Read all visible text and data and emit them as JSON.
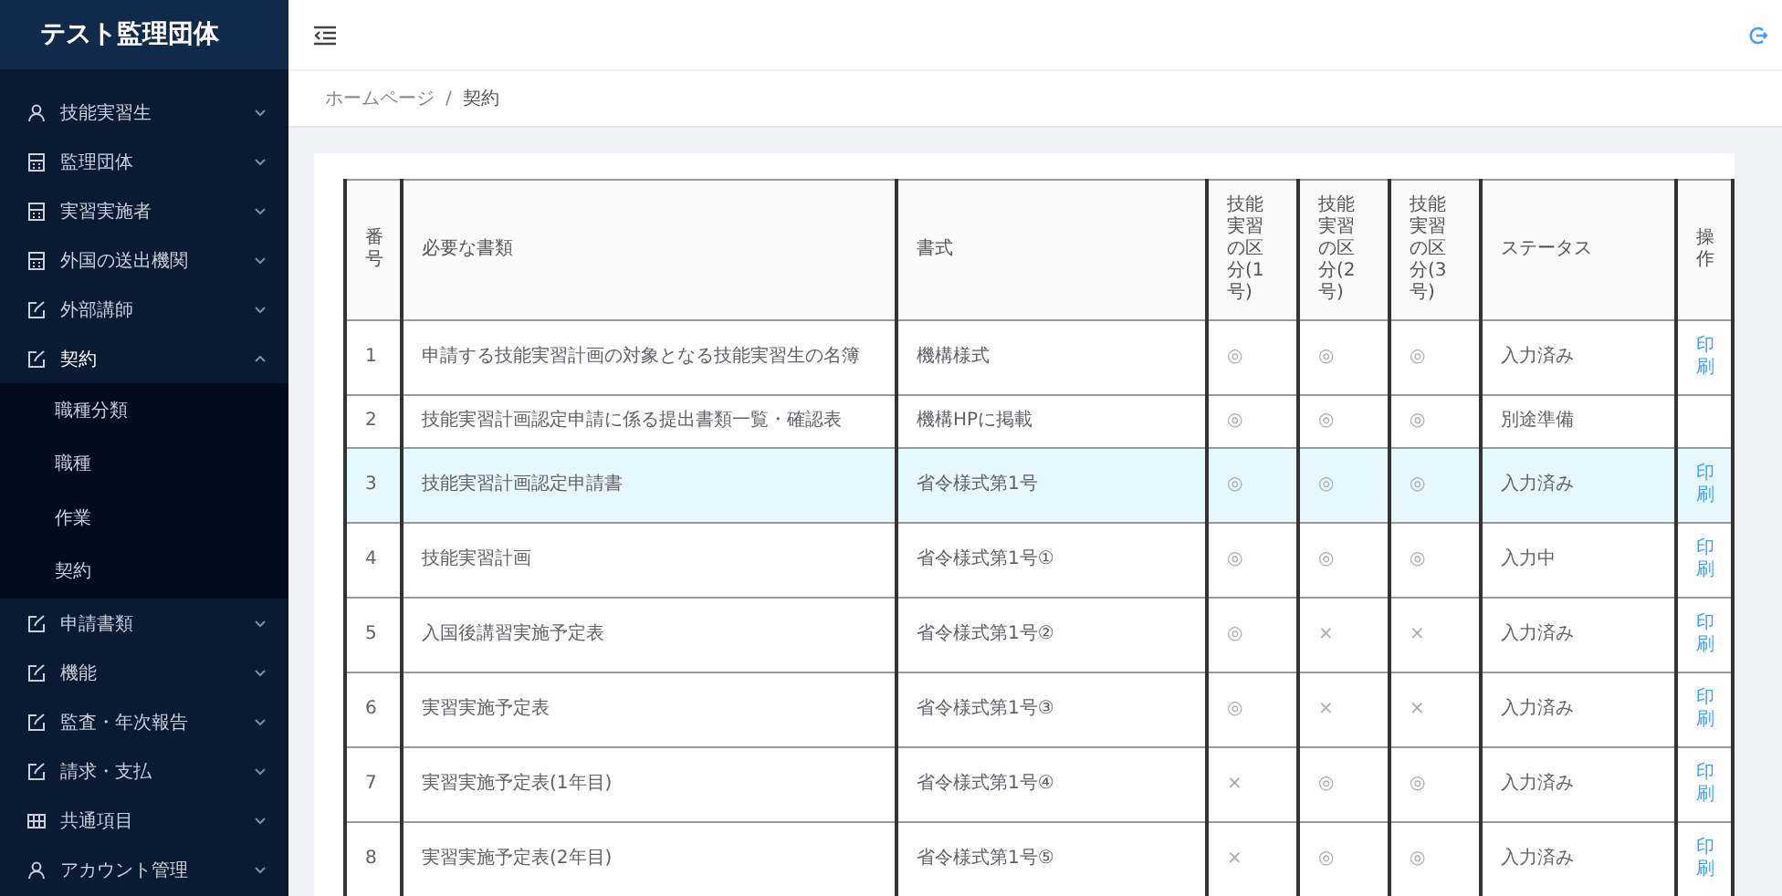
{
  "sidebar": {
    "title": "テスト監理団体",
    "items": [
      {
        "label": "技能実習生",
        "kind": "person",
        "expanded": false
      },
      {
        "label": "監理団体",
        "kind": "building",
        "expanded": false
      },
      {
        "label": "実習実施者",
        "kind": "building",
        "expanded": false
      },
      {
        "label": "外国の送出機関",
        "kind": "building",
        "expanded": false
      },
      {
        "label": "外部講師",
        "kind": "edit",
        "expanded": false
      },
      {
        "label": "契約",
        "kind": "edit",
        "expanded": true,
        "children": [
          {
            "label": "職種分類"
          },
          {
            "label": "職種"
          },
          {
            "label": "作業"
          },
          {
            "label": "契約"
          }
        ]
      },
      {
        "label": "申請書類",
        "kind": "edit",
        "expanded": false
      },
      {
        "label": "機能",
        "kind": "edit",
        "expanded": false
      },
      {
        "label": "監査・年次報告",
        "kind": "edit",
        "expanded": false
      },
      {
        "label": "請求・支払",
        "kind": "edit",
        "expanded": false
      },
      {
        "label": "共通項目",
        "kind": "grid",
        "expanded": false
      },
      {
        "label": "アカウント管理",
        "kind": "person",
        "expanded": false
      }
    ]
  },
  "breadcrumb": {
    "items": [
      "ホームページ",
      "契約"
    ],
    "separator": "/"
  },
  "table": {
    "columns": [
      "番号",
      "必要な書類",
      "書式",
      "技能実習の区分(1号)",
      "技能実習の区分(2号)",
      "技能実習の区分(3号)",
      "ステータス",
      "操作"
    ],
    "rows": [
      {
        "no": "1",
        "document": "申請する技能実習計画の対象となる技能実習生の名簿",
        "format": "機構様式",
        "marks": [
          "◎",
          "◎",
          "◎"
        ],
        "status": "入力済み",
        "action": "印刷",
        "selected": false
      },
      {
        "no": "2",
        "document": "技能実習計画認定申請に係る提出書類一覧・確認表",
        "format": "機構HPに掲載",
        "marks": [
          "◎",
          "◎",
          "◎"
        ],
        "status": "別途準備",
        "selected": false
      },
      {
        "no": "3",
        "document": "技能実習計画認定申請書",
        "format": "省令様式第1号",
        "marks": [
          "◎",
          "◎",
          "◎"
        ],
        "status": "入力済み",
        "action": "印刷",
        "selected": true
      },
      {
        "no": "4",
        "document": "技能実習計画",
        "format": "省令様式第1号①",
        "marks": [
          "◎",
          "◎",
          "◎"
        ],
        "status": "入力中",
        "action": "印刷",
        "selected": false
      },
      {
        "no": "5",
        "document": "入国後講習実施予定表",
        "format": "省令様式第1号②",
        "marks": [
          "◎",
          "×",
          "×"
        ],
        "status": "入力済み",
        "action": "印刷",
        "selected": false
      },
      {
        "no": "6",
        "document": "実習実施予定表",
        "format": "省令様式第1号③",
        "marks": [
          "◎",
          "×",
          "×"
        ],
        "status": "入力済み",
        "action": "印刷",
        "selected": false
      },
      {
        "no": "7",
        "document": "実習実施予定表(1年目)",
        "format": "省令様式第1号④",
        "marks": [
          "×",
          "◎",
          "◎"
        ],
        "status": "入力済み",
        "action": "印刷",
        "selected": false
      },
      {
        "no": "8",
        "document": "実習実施予定表(2年目)",
        "format": "省令様式第1号⑤",
        "marks": [
          "×",
          "◎",
          "◎"
        ],
        "status": "入力済み",
        "action": "印刷",
        "selected": false
      }
    ]
  }
}
